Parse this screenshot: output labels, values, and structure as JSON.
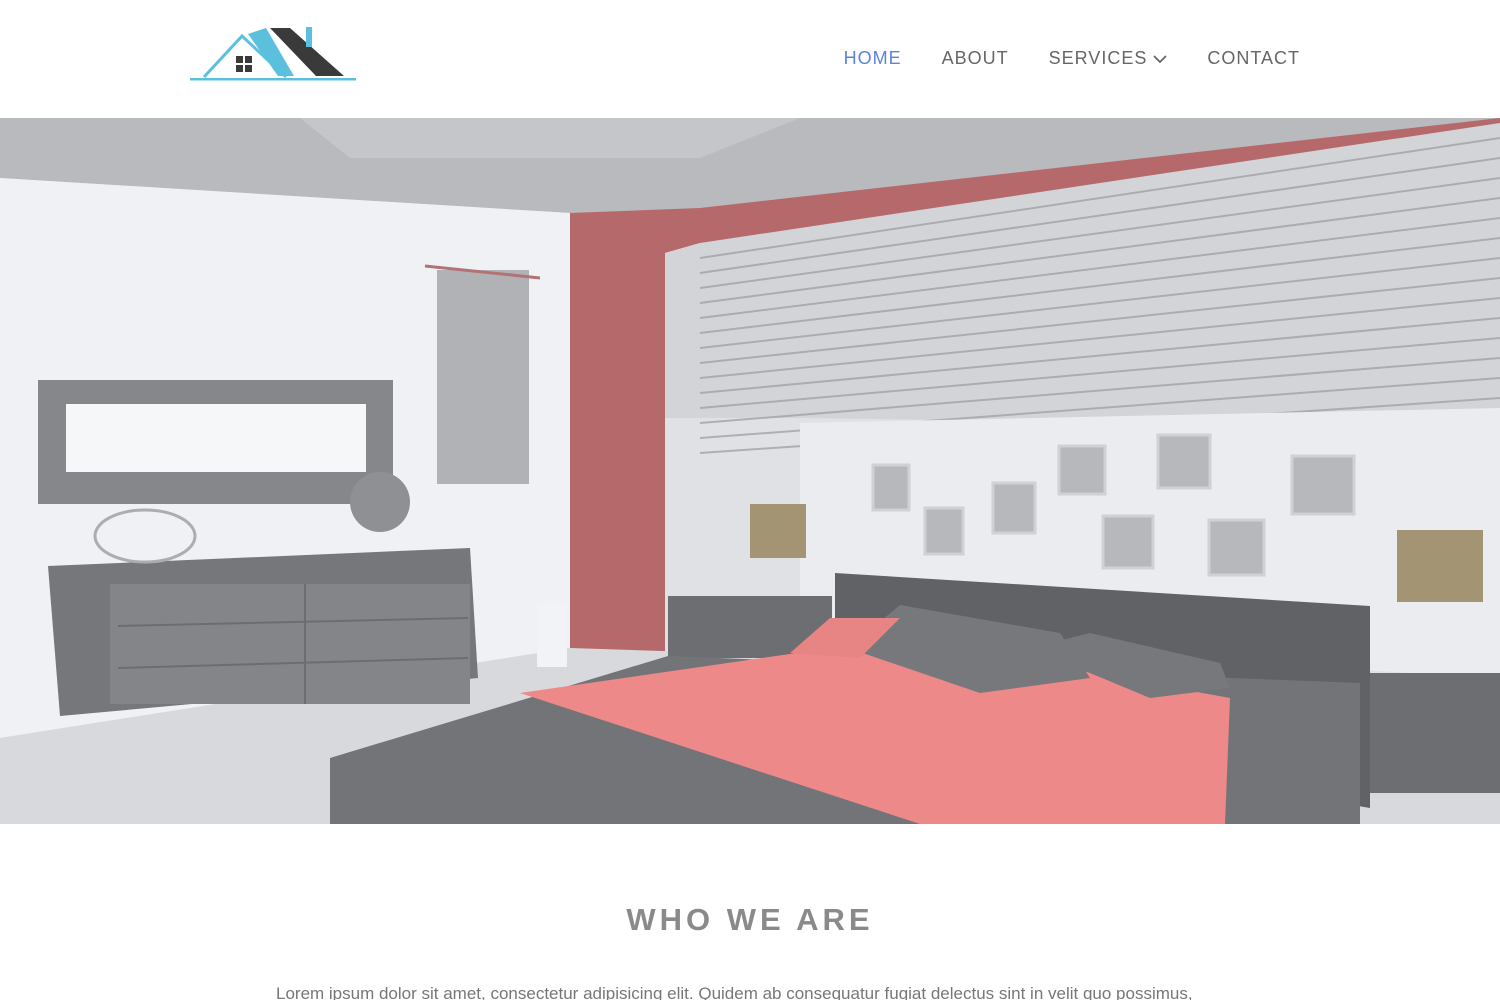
{
  "header": {
    "logo_label": "House roof logo",
    "nav": [
      {
        "label": "HOME",
        "active": true
      },
      {
        "label": "ABOUT",
        "active": false
      },
      {
        "label": "SERVICES",
        "active": false,
        "has_dropdown": true
      },
      {
        "label": "CONTACT",
        "active": false
      }
    ]
  },
  "hero": {
    "image_description": "Modern bedroom interior with red accent wall, window blinds and a large low bed"
  },
  "about": {
    "title": "WHO WE ARE",
    "text": "Lorem ipsum dolor sit amet, consectetur adipisicing elit. Quidem ab consequatur fugiat delectus sint in velit quo possimus,"
  },
  "colors": {
    "accent": "#5b83d8",
    "logo_blue": "#5bc0de",
    "logo_dark": "#333333",
    "nav_text": "#666666",
    "title_text": "#8a8a8a"
  }
}
